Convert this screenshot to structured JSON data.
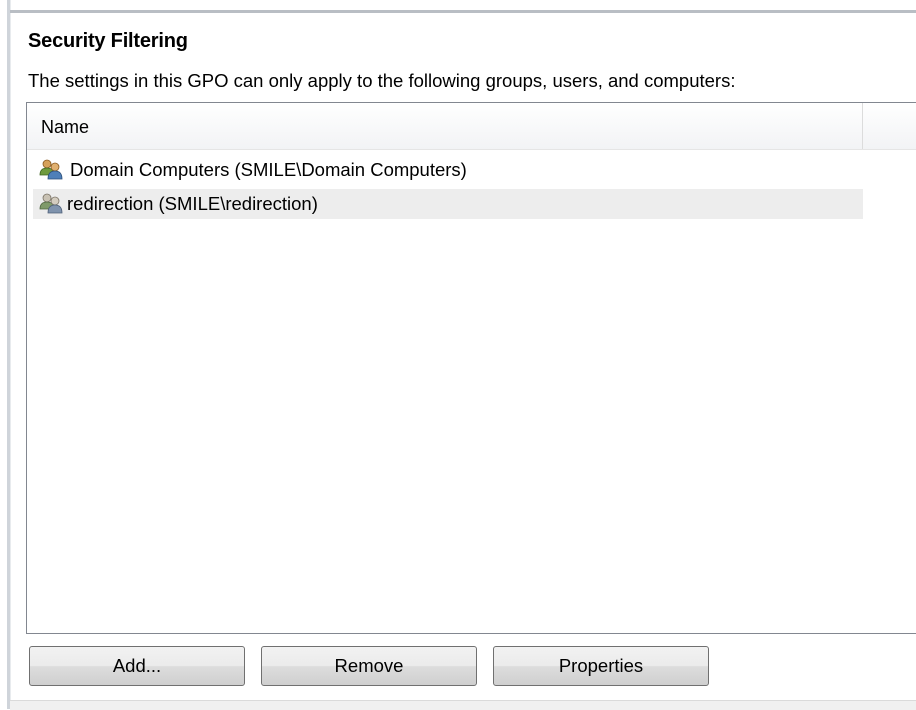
{
  "section": {
    "title": "Security Filtering",
    "description": "The settings in this GPO can only apply to the following groups, users, and computers:"
  },
  "list": {
    "columns": [
      "Name"
    ],
    "items": [
      {
        "label": "Domain Computers (SMILE\\Domain Computers)",
        "icon": "group-icon",
        "selected": false
      },
      {
        "label": "redirection (SMILE\\redirection)",
        "icon": "group-icon",
        "selected": true
      }
    ]
  },
  "buttons": {
    "add_label": "Add...",
    "remove_label": "Remove",
    "properties_label": "Properties"
  },
  "colors": {
    "selected_row": "#ededed",
    "border": "#828790"
  }
}
